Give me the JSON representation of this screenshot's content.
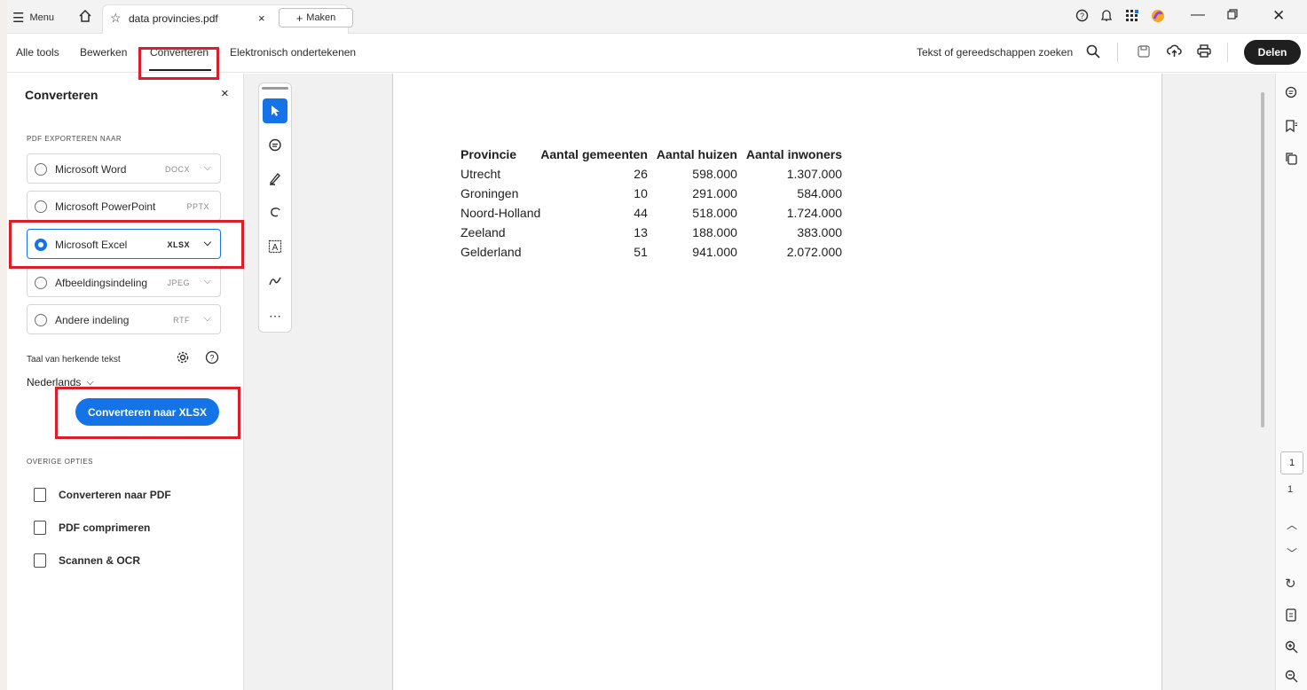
{
  "titlebar": {
    "menu_label": "Menu",
    "tab_title": "data provincies.pdf",
    "maken_label": "Maken"
  },
  "menubar": {
    "tabs": [
      "Alle tools",
      "Bewerken",
      "Converteren",
      "Elektronisch ondertekenen"
    ],
    "search_label": "Tekst of gereedschappen zoeken",
    "share_label": "Delen"
  },
  "panel": {
    "title": "Converteren",
    "export_heading": "PDF EXPORTEREN NAAR",
    "options": [
      {
        "label": "Microsoft Word",
        "format": "DOCX",
        "selected": false
      },
      {
        "label": "Microsoft PowerPoint",
        "format": "PPTX",
        "selected": false
      },
      {
        "label": "Microsoft Excel",
        "format": "XLSX",
        "selected": true
      },
      {
        "label": "Afbeeldingsindeling",
        "format": "JPEG",
        "selected": false
      },
      {
        "label": "Andere indeling",
        "format": "RTF",
        "selected": false
      }
    ],
    "language_label": "Taal van herkende tekst",
    "language_value": "Nederlands",
    "convert_button": "Converteren naar XLSX",
    "other_heading": "OVERIGE OPTIES",
    "other_options": [
      "Converteren naar PDF",
      "PDF comprimeren",
      "Scannen & OCR"
    ]
  },
  "document": {
    "headers": [
      "Provincie",
      "Aantal gemeenten",
      "Aantal huizen",
      "Aantal inwoners"
    ],
    "rows": [
      [
        "Utrecht",
        "26",
        "598.000",
        "1.307.000"
      ],
      [
        "Groningen",
        "10",
        "291.000",
        "584.000"
      ],
      [
        "Noord-Holland",
        "44",
        "518.000",
        "1.724.000"
      ],
      [
        "Zeeland",
        "13",
        "188.000",
        "383.000"
      ],
      [
        "Gelderland",
        "51",
        "941.000",
        "2.072.000"
      ]
    ]
  },
  "rail": {
    "page_current": "1",
    "page_total": "1"
  },
  "colors": {
    "accent": "#1473e6",
    "highlight": "#d81f2a"
  }
}
